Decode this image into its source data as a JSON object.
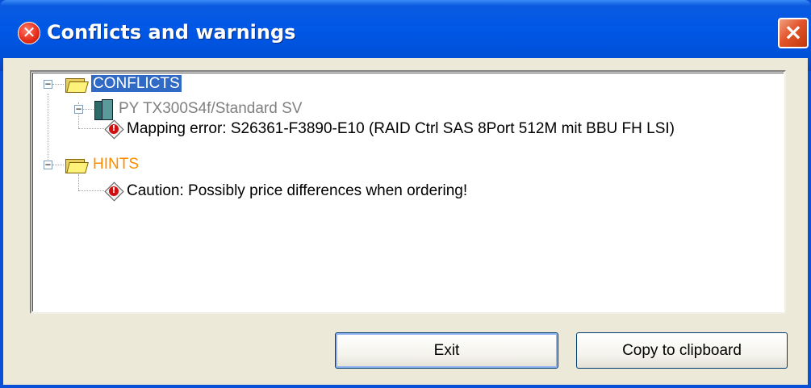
{
  "window": {
    "title": "Conflicts and warnings",
    "close_label": "×"
  },
  "tree": {
    "conflicts": {
      "label": "CONFLICTS",
      "children": [
        {
          "label": "PY TX300S4f/Standard SV",
          "children": [
            {
              "label": "Mapping error: S26361-F3890-E10 (RAID Ctrl SAS 8Port 512M mit BBU FH LSI)"
            }
          ]
        }
      ]
    },
    "hints": {
      "label": "HINTS",
      "children": [
        {
          "label": "Caution: Possibly price differences when ordering!"
        }
      ]
    }
  },
  "buttons": {
    "exit": "Exit",
    "copy": "Copy to clipboard"
  },
  "icons": {
    "title": "error-icon",
    "folder": "folder-open-icon",
    "server": "server-icon",
    "error": "warning-diamond-icon"
  },
  "colors": {
    "titlebar": "#0058e6",
    "selection": "#316ac5",
    "hints_label": "#ff8c00",
    "disabled_text": "#808080"
  }
}
